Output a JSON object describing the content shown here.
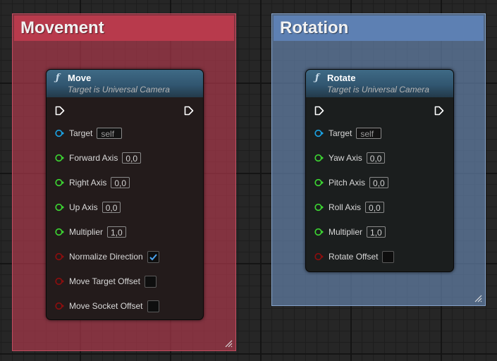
{
  "comments": {
    "movement": {
      "title": "Movement",
      "color": "#b83a4c"
    },
    "rotation": {
      "title": "Rotation",
      "color": "#5d80b3"
    }
  },
  "nodes": {
    "move": {
      "icon": "function-icon",
      "title": "Move",
      "subtitle": "Target is Universal Camera",
      "pins": [
        {
          "label": "Target",
          "value": "self",
          "type": "object",
          "color": "#1ba1e2"
        },
        {
          "label": "Forward Axis",
          "value": "0,0",
          "type": "float",
          "color": "#3cd432"
        },
        {
          "label": "Right Axis",
          "value": "0,0",
          "type": "float",
          "color": "#3cd432"
        },
        {
          "label": "Up Axis",
          "value": "0,0",
          "type": "float",
          "color": "#3cd432"
        },
        {
          "label": "Multiplier",
          "value": "1,0",
          "type": "float",
          "color": "#3cd432"
        },
        {
          "label": "Normalize Direction",
          "checked": true,
          "type": "bool",
          "color": "#8b0e0e"
        },
        {
          "label": "Move Target Offset",
          "checked": false,
          "type": "bool",
          "color": "#8b0e0e"
        },
        {
          "label": "Move Socket Offset",
          "checked": false,
          "type": "bool",
          "color": "#8b0e0e"
        }
      ]
    },
    "rotate": {
      "icon": "function-icon",
      "title": "Rotate",
      "subtitle": "Target is Universal Camera",
      "pins": [
        {
          "label": "Target",
          "value": "self",
          "type": "object",
          "color": "#1ba1e2"
        },
        {
          "label": "Yaw Axis",
          "value": "0,0",
          "type": "float",
          "color": "#3cd432"
        },
        {
          "label": "Pitch Axis",
          "value": "0,0",
          "type": "float",
          "color": "#3cd432"
        },
        {
          "label": "Roll Axis",
          "value": "0,0",
          "type": "float",
          "color": "#3cd432"
        },
        {
          "label": "Multiplier",
          "value": "1,0",
          "type": "float",
          "color": "#3cd432"
        },
        {
          "label": "Rotate Offset",
          "checked": false,
          "type": "bool",
          "color": "#8b0e0e"
        }
      ]
    }
  },
  "colors": {
    "checkmark": "#4aa3ef",
    "exec_pin": "#ffffff"
  }
}
